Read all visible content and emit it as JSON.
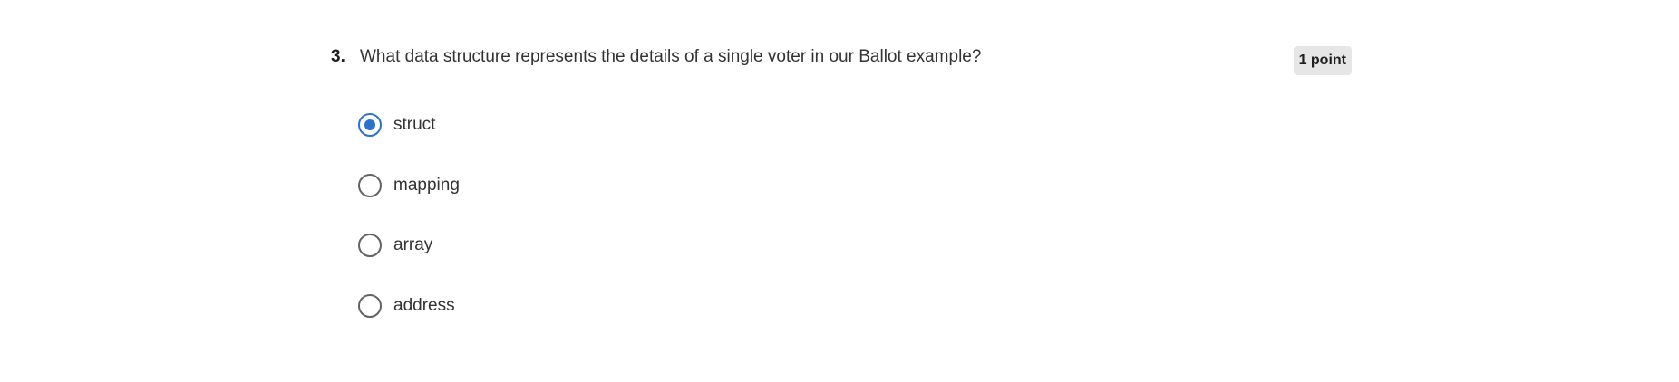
{
  "question": {
    "number": "3.",
    "text": "What data structure represents the details of a single voter in our Ballot example?",
    "points": "1 point"
  },
  "options": [
    {
      "label": "struct",
      "selected": true
    },
    {
      "label": "mapping",
      "selected": false
    },
    {
      "label": "array",
      "selected": false
    },
    {
      "label": "address",
      "selected": false
    }
  ],
  "colors": {
    "selected_radio": "#2a73cc",
    "unselected_radio": "#636363",
    "badge_background": "#e6e6e6"
  }
}
